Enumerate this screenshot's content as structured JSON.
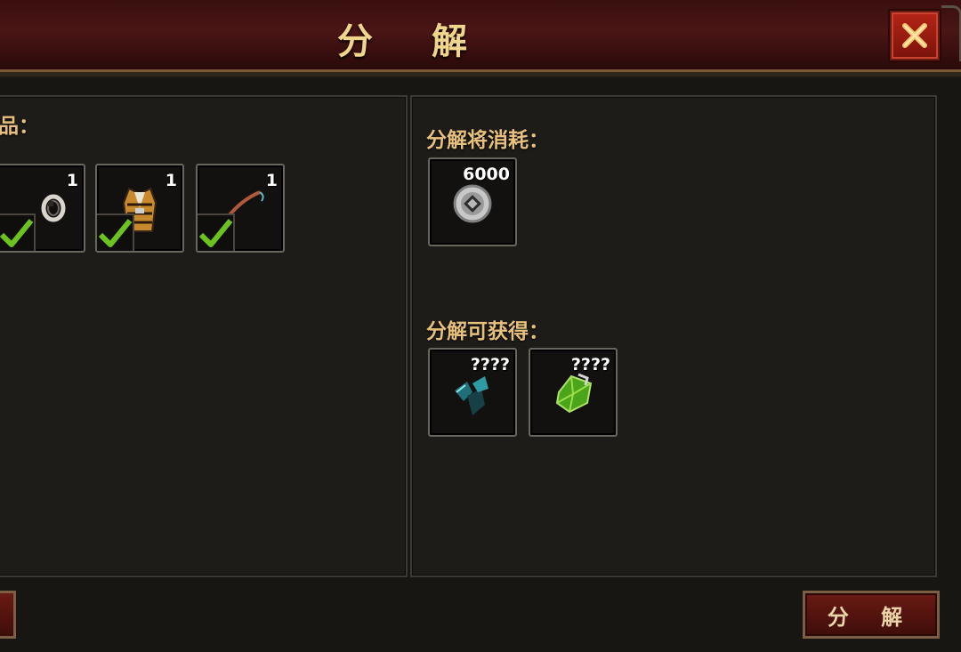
{
  "window": {
    "title": "分 解",
    "close_label": "close"
  },
  "left_panel": {
    "partial_label": "品：",
    "items": [
      {
        "name": "bracelet",
        "count": "1",
        "checked": true
      },
      {
        "name": "robe",
        "count": "1",
        "checked": true
      },
      {
        "name": "whip",
        "count": "1",
        "checked": true
      }
    ]
  },
  "right_panel": {
    "consume_label": "分解将消耗：",
    "consume_items": [
      {
        "name": "silver-coin",
        "count": "6000"
      }
    ],
    "obtain_label": "分解可获得：",
    "obtain_items": [
      {
        "name": "dark-crystal",
        "count": "????"
      },
      {
        "name": "green-gem",
        "count": "????"
      }
    ]
  },
  "actions": {
    "decompose_label": "分 解"
  },
  "colors": {
    "title": "#f2d58c",
    "label": "#e7c07c",
    "accent_red": "#b52416"
  }
}
